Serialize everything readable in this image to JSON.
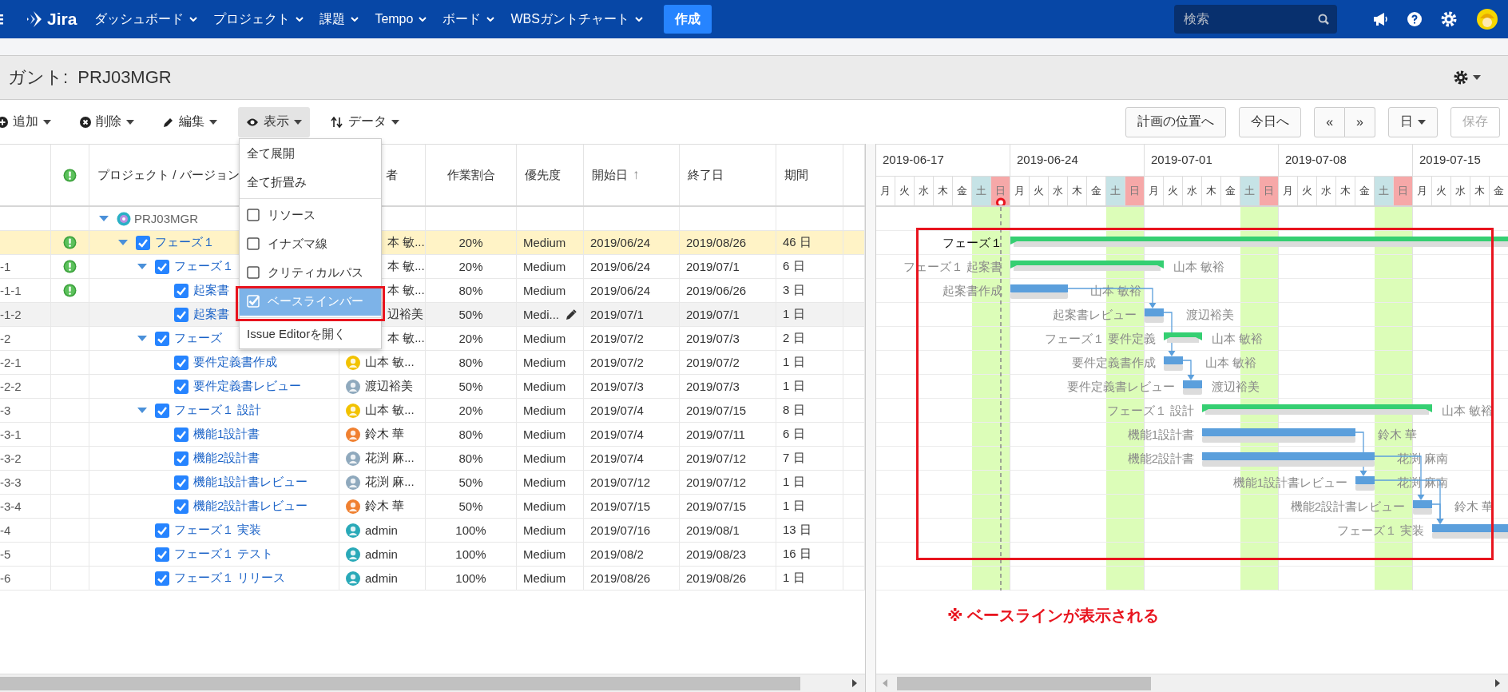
{
  "nav": {
    "logo": "Jira",
    "menus": [
      "ダッシュボード",
      "プロジェクト",
      "課題",
      "Tempo",
      "ボード",
      "WBSガントチャート"
    ],
    "create": "作成",
    "search_placeholder": "検索"
  },
  "page_title": "ガント:  PRJ03MGR",
  "toolbar": {
    "left": [
      {
        "kind": "add",
        "label": "追加",
        "open": false
      },
      {
        "kind": "delete",
        "label": "削除",
        "open": false
      },
      {
        "kind": "edit",
        "label": "編集",
        "open": false
      },
      {
        "kind": "view",
        "label": "表示",
        "open": true,
        "menu": [
          {
            "kind": "action",
            "label": "全て展開"
          },
          {
            "kind": "action",
            "label": "全て折畳み"
          },
          {
            "kind": "divider"
          },
          {
            "kind": "check",
            "label": "リソース",
            "checked": false,
            "selected": false
          },
          {
            "kind": "check",
            "label": "イナズマ線",
            "checked": false,
            "selected": false
          },
          {
            "kind": "check",
            "label": "クリティカルパス",
            "checked": false,
            "selected": false
          },
          {
            "kind": "check",
            "label": "ベースラインバー",
            "checked": true,
            "selected": true
          },
          {
            "kind": "divider"
          },
          {
            "kind": "action",
            "label": "Issue Editorを開く"
          }
        ]
      },
      {
        "kind": "data",
        "label": "データ",
        "open": false
      }
    ],
    "right": [
      {
        "kind": "plan",
        "label": "計画の位置へ",
        "disabled": false
      },
      {
        "kind": "today",
        "label": "今日へ",
        "disabled": false
      },
      {
        "kind": "pager",
        "labels": [
          "«",
          "»"
        ],
        "disabled": false
      },
      {
        "kind": "scale",
        "label": "日",
        "disabled": false
      },
      {
        "kind": "save",
        "label": "保存",
        "disabled": true
      }
    ]
  },
  "table": {
    "columns": [
      {
        "kind": "blank"
      },
      {
        "kind": "alert"
      },
      {
        "kind": "text",
        "label": "プロジェクト / バージョン"
      },
      {
        "kind": "text",
        "label": "者"
      },
      {
        "kind": "text",
        "label": "作業割合"
      },
      {
        "kind": "text",
        "label": "優先度"
      },
      {
        "kind": "text",
        "label": "開始日",
        "sort": "↑"
      },
      {
        "kind": "text",
        "label": "終了日"
      },
      {
        "kind": "text",
        "label": "期間"
      },
      {
        "kind": "blank"
      }
    ],
    "rows": [
      {
        "kind": "project",
        "name": "PRJ03MGR",
        "expanded": true,
        "selected": false,
        "highlighted": false,
        "children": [
          {
            "kind": "issue",
            "name": "フェーズ１",
            "checked": true,
            "alert": true,
            "expanded": true,
            "selected": true,
            "highlighted": false,
            "assignee": "本 敏...",
            "progress": "20%",
            "priority": "Medium",
            "start": "2019/06/24",
            "end": "2019/08/26",
            "duration": "46 日",
            "children": [
              {
                "kind": "issue",
                "code": "-1",
                "name": "フェーズ１",
                "checked": true,
                "alert": true,
                "expanded": true,
                "selected": false,
                "highlighted": false,
                "assignee": "本 敏...",
                "progress": "20%",
                "priority": "Medium",
                "start": "2019/06/24",
                "end": "2019/07/1",
                "duration": "6 日",
                "children": [
                  {
                    "kind": "issue",
                    "code": "-1-1",
                    "name": "起案書",
                    "checked": true,
                    "alert": true,
                    "selected": false,
                    "highlighted": false,
                    "assignee": "本 敏...",
                    "progress": "80%",
                    "priority": "Medium",
                    "start": "2019/06/24",
                    "end": "2019/06/26",
                    "duration": "3 日"
                  },
                  {
                    "kind": "issue",
                    "code": "-1-2",
                    "name": "起案書",
                    "checked": true,
                    "alert": false,
                    "selected": false,
                    "highlighted": true,
                    "assignee": "辺裕美",
                    "progress": "50%",
                    "priority": "Medi...",
                    "editable": true,
                    "start": "2019/07/1",
                    "end": "2019/07/1",
                    "duration": "1 日"
                  }
                ]
              },
              {
                "kind": "issue",
                "code": "-2",
                "name": "フェーズ",
                "checked": true,
                "alert": false,
                "expanded": true,
                "selected": false,
                "highlighted": false,
                "assignee": "本 敏...",
                "progress": "20%",
                "priority": "Medium",
                "start": "2019/07/2",
                "end": "2019/07/3",
                "duration": "2 日",
                "children": [
                  {
                    "kind": "issue",
                    "code": "-2-1",
                    "name": "要件定義書作成",
                    "checked": true,
                    "alert": false,
                    "selected": false,
                    "highlighted": false,
                    "color": "#f2c200",
                    "assignee": "山本 敏...",
                    "progress": "80%",
                    "priority": "Medium",
                    "start": "2019/07/2",
                    "end": "2019/07/2",
                    "duration": "1 日"
                  },
                  {
                    "kind": "issue",
                    "code": "-2-2",
                    "name": "要件定義書レビュー",
                    "checked": true,
                    "alert": false,
                    "selected": false,
                    "highlighted": false,
                    "color": "#8fa9bd",
                    "assignee": "渡辺裕美",
                    "progress": "50%",
                    "priority": "Medium",
                    "start": "2019/07/3",
                    "end": "2019/07/3",
                    "duration": "1 日"
                  }
                ]
              },
              {
                "kind": "issue",
                "code": "-3",
                "name": "フェーズ１ 設計",
                "checked": true,
                "alert": false,
                "expanded": true,
                "selected": false,
                "highlighted": false,
                "color": "#f2c200",
                "assignee": "山本 敏...",
                "progress": "20%",
                "priority": "Medium",
                "start": "2019/07/4",
                "end": "2019/07/15",
                "duration": "8 日",
                "children": [
                  {
                    "kind": "issue",
                    "code": "-3-1",
                    "name": "機能1設計書",
                    "checked": true,
                    "alert": false,
                    "selected": false,
                    "highlighted": false,
                    "color": "#f08030",
                    "assignee": "鈴木 華",
                    "progress": "80%",
                    "priority": "Medium",
                    "start": "2019/07/4",
                    "end": "2019/07/11",
                    "duration": "6 日"
                  },
                  {
                    "kind": "issue",
                    "code": "-3-2",
                    "name": "機能2設計書",
                    "checked": true,
                    "alert": false,
                    "selected": false,
                    "highlighted": false,
                    "color": "#8fa9bd",
                    "assignee": "花渕 麻...",
                    "progress": "80%",
                    "priority": "Medium",
                    "start": "2019/07/4",
                    "end": "2019/07/12",
                    "duration": "7 日"
                  },
                  {
                    "kind": "issue",
                    "code": "-3-3",
                    "name": "機能1設計書レビュー",
                    "checked": true,
                    "alert": false,
                    "selected": false,
                    "highlighted": false,
                    "color": "#8fa9bd",
                    "assignee": "花渕 麻...",
                    "progress": "50%",
                    "priority": "Medium",
                    "start": "2019/07/12",
                    "end": "2019/07/12",
                    "duration": "1 日"
                  },
                  {
                    "kind": "issue",
                    "code": "-3-4",
                    "name": "機能2設計書レビュー",
                    "checked": true,
                    "alert": false,
                    "selected": false,
                    "highlighted": false,
                    "color": "#f08030",
                    "assignee": "鈴木 華",
                    "progress": "50%",
                    "priority": "Medium",
                    "start": "2019/07/15",
                    "end": "2019/07/15",
                    "duration": "1 日"
                  }
                ]
              },
              {
                "kind": "issue",
                "code": "-4",
                "name": "フェーズ１ 実装",
                "checked": true,
                "alert": false,
                "selected": false,
                "highlighted": false,
                "color": "#29a9b8",
                "assignee": "admin",
                "progress": "100%",
                "priority": "Medium",
                "start": "2019/07/16",
                "end": "2019/08/1",
                "duration": "13 日"
              },
              {
                "kind": "issue",
                "code": "-5",
                "name": "フェーズ１ テスト",
                "checked": true,
                "alert": false,
                "selected": false,
                "highlighted": false,
                "color": "#29a9b8",
                "assignee": "admin",
                "progress": "100%",
                "priority": "Medium",
                "start": "2019/08/2",
                "end": "2019/08/23",
                "duration": "16 日"
              },
              {
                "kind": "issue",
                "code": "-6",
                "name": "フェーズ１ リリース",
                "checked": true,
                "alert": false,
                "selected": false,
                "highlighted": false,
                "color": "#29a9b8",
                "assignee": "admin",
                "progress": "100%",
                "priority": "Medium",
                "start": "2019/08/26",
                "end": "2019/08/26",
                "duration": "1 日"
              }
            ]
          }
        ]
      }
    ]
  },
  "gantt": {
    "weeks": [
      {
        "date": "2019-06-17",
        "days": [
          {
            "label": "月",
            "kind": "weekday",
            "today": false
          },
          {
            "label": "火",
            "kind": "weekday",
            "today": false
          },
          {
            "label": "水",
            "kind": "weekday",
            "today": false
          },
          {
            "label": "木",
            "kind": "weekday",
            "today": false
          },
          {
            "label": "金",
            "kind": "weekday",
            "today": false
          },
          {
            "label": "土",
            "kind": "saturday",
            "today": false
          },
          {
            "label": "日",
            "kind": "sunday",
            "today": true
          }
        ]
      },
      {
        "date": "2019-06-24",
        "days": [
          {
            "label": "月",
            "kind": "weekday",
            "today": false
          },
          {
            "label": "火",
            "kind": "weekday",
            "today": false
          },
          {
            "label": "水",
            "kind": "weekday",
            "today": false
          },
          {
            "label": "木",
            "kind": "weekday",
            "today": false
          },
          {
            "label": "金",
            "kind": "weekday",
            "today": false
          },
          {
            "label": "土",
            "kind": "saturday",
            "today": false
          },
          {
            "label": "日",
            "kind": "sunday",
            "today": false
          }
        ]
      },
      {
        "date": "2019-07-01",
        "days": [
          {
            "label": "月",
            "kind": "weekday",
            "today": false
          },
          {
            "label": "火",
            "kind": "weekday",
            "today": false
          },
          {
            "label": "水",
            "kind": "weekday",
            "today": false
          },
          {
            "label": "木",
            "kind": "weekday",
            "today": false
          },
          {
            "label": "金",
            "kind": "weekday",
            "today": false
          },
          {
            "label": "土",
            "kind": "saturday",
            "today": false
          },
          {
            "label": "日",
            "kind": "sunday",
            "today": false
          }
        ]
      },
      {
        "date": "2019-07-08",
        "days": [
          {
            "label": "月",
            "kind": "weekday",
            "today": false
          },
          {
            "label": "火",
            "kind": "weekday",
            "today": false
          },
          {
            "label": "水",
            "kind": "weekday",
            "today": false
          },
          {
            "label": "木",
            "kind": "weekday",
            "today": false
          },
          {
            "label": "金",
            "kind": "weekday",
            "today": false
          },
          {
            "label": "土",
            "kind": "saturday",
            "today": false
          },
          {
            "label": "日",
            "kind": "sunday",
            "today": false
          }
        ]
      },
      {
        "date": "2019-07-15",
        "days": [
          {
            "label": "月",
            "kind": "weekday",
            "today": false
          },
          {
            "label": "火",
            "kind": "weekday",
            "today": false
          },
          {
            "label": "水",
            "kind": "weekday",
            "today": false
          },
          {
            "label": "木",
            "kind": "weekday",
            "today": false
          },
          {
            "label": "金",
            "kind": "weekday",
            "today": false
          }
        ]
      }
    ],
    "rows": [
      {
        "kind": "blank"
      },
      {
        "kind": "summary",
        "label": "フェーズ１",
        "baseline": true,
        "selected": true
      },
      {
        "kind": "summary",
        "label": "フェーズ１ 起案書",
        "resource": "山本 敏裕",
        "baseline": true,
        "selected": false
      },
      {
        "kind": "task",
        "label": "起案書作成",
        "resource": "山本 敏裕",
        "baseline": true,
        "selected": false,
        "arrow_next": true,
        "arrow_skip": false
      },
      {
        "kind": "task",
        "label": "起案書レビュー",
        "resource": "渡辺裕美",
        "baseline": true,
        "selected": false,
        "arrow_next": false,
        "arrow_skip": true
      },
      {
        "kind": "summary",
        "label": "フェーズ１ 要件定義",
        "resource": "山本 敏裕",
        "baseline": true,
        "selected": false
      },
      {
        "kind": "task",
        "label": "要件定義書作成",
        "resource": "山本 敏裕",
        "baseline": true,
        "selected": false,
        "arrow_next": true,
        "arrow_skip": false
      },
      {
        "kind": "task",
        "label": "要件定義書レビュー",
        "resource": "渡辺裕美",
        "baseline": true,
        "selected": false,
        "arrow_next": false,
        "arrow_skip": false
      },
      {
        "kind": "summary",
        "label": "フェーズ１ 設計",
        "resource": "山本 敏裕",
        "baseline": true,
        "selected": false
      },
      {
        "kind": "task",
        "label": "機能1設計書",
        "resource": "鈴木 華",
        "baseline": true,
        "selected": false,
        "arrow_next": false,
        "arrow_skip": true
      },
      {
        "kind": "task",
        "label": "機能2設計書",
        "resource": "花渕 麻南",
        "baseline": true,
        "selected": false,
        "arrow_next": false,
        "arrow_skip": true
      },
      {
        "kind": "task",
        "label": "機能1設計書レビュー",
        "resource": "花渕 麻南",
        "baseline": true,
        "selected": false,
        "arrow_next": false,
        "arrow_skip": true
      },
      {
        "kind": "task",
        "label": "機能2設計書レビュー",
        "resource": "鈴木 華",
        "baseline": true,
        "selected": false,
        "arrow_next": true,
        "arrow_skip": false
      },
      {
        "kind": "task",
        "label": "フェーズ１ 実装",
        "baseline": true,
        "selected": false,
        "arrow_next": false,
        "arrow_skip": false
      },
      {
        "kind": "blank"
      },
      {
        "kind": "blank"
      }
    ]
  },
  "annotation": {
    "text": "※ ベースラインが表示される",
    "frame_menu_item": true,
    "frame_chart": true
  }
}
